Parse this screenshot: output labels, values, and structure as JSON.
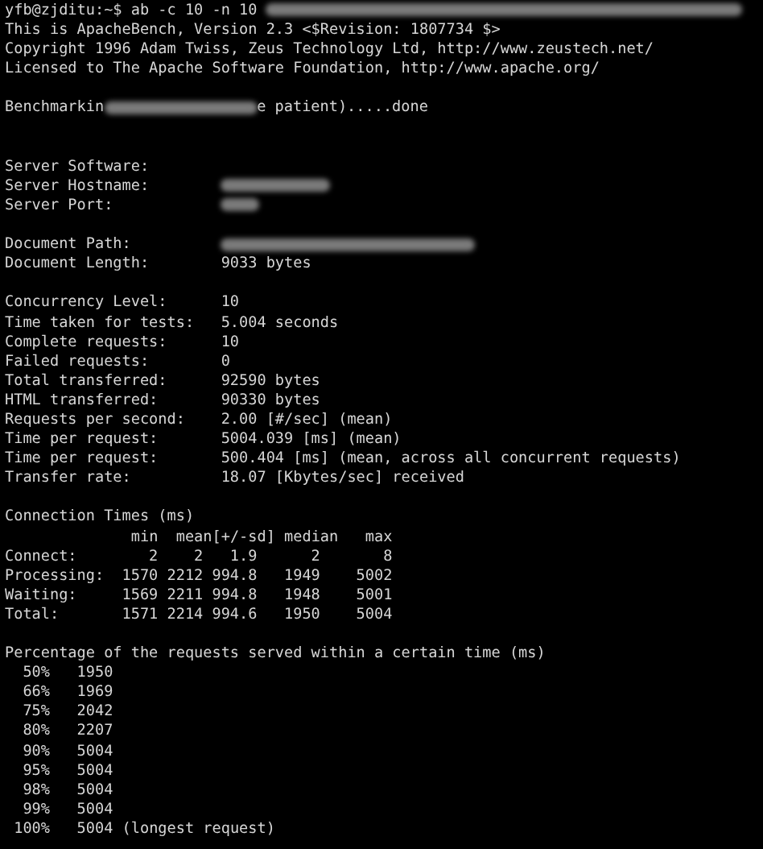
{
  "blocks": [
    {
      "lines": [
        [
          {
            "kind": "text",
            "text": "yfb@zjditu:~$ ab -c 10 -n 10 "
          },
          {
            "kind": "redacted"
          }
        ],
        [
          {
            "kind": "text",
            "text": "This is ApacheBench, Version 2.3 <$Revision: 1807734 $>"
          }
        ],
        [
          {
            "kind": "text",
            "text": "Copyright 1996 Adam Twiss, Zeus Technology Ltd, http://www.zeustech.net/"
          }
        ],
        [
          {
            "kind": "text",
            "text": "Licensed to The Apache Software Foundation, http://www.apache.org/"
          }
        ]
      ]
    },
    {
      "lines": [
        [
          {
            "kind": "text",
            "text": "Benchmarkin"
          },
          {
            "kind": "redacted"
          },
          {
            "kind": "text",
            "text": "e patient).....done"
          }
        ]
      ]
    },
    {
      "lines": [
        [
          {
            "kind": "text",
            "text": "Server Software:"
          }
        ],
        [
          {
            "kind": "text",
            "text": "Server Hostname:        "
          },
          {
            "kind": "redacted"
          }
        ],
        [
          {
            "kind": "text",
            "text": "Server Port:            "
          },
          {
            "kind": "redacted"
          }
        ]
      ]
    },
    {
      "lines": [
        [
          {
            "kind": "text",
            "text": "Document Path:          "
          },
          {
            "kind": "redacted"
          }
        ],
        [
          {
            "kind": "text",
            "text": "Document Length:        9033 bytes"
          }
        ]
      ]
    },
    {
      "lines": [
        [
          {
            "kind": "text",
            "text": "Concurrency Level:      10"
          }
        ],
        [
          {
            "kind": "text",
            "text": "Time taken for tests:   5.004 seconds"
          }
        ],
        [
          {
            "kind": "text",
            "text": "Complete requests:      10"
          }
        ],
        [
          {
            "kind": "text",
            "text": "Failed requests:        0"
          }
        ],
        [
          {
            "kind": "text",
            "text": "Total transferred:      92590 bytes"
          }
        ],
        [
          {
            "kind": "text",
            "text": "HTML transferred:       90330 bytes"
          }
        ],
        [
          {
            "kind": "text",
            "text": "Requests per second:    2.00 [#/sec] (mean)"
          }
        ],
        [
          {
            "kind": "text",
            "text": "Time per request:       5004.039 [ms] (mean)"
          }
        ],
        [
          {
            "kind": "text",
            "text": "Time per request:       500.404 [ms] (mean, across all concurrent requests)"
          }
        ],
        [
          {
            "kind": "text",
            "text": "Transfer rate:          18.07 [Kbytes/sec] received"
          }
        ]
      ]
    },
    {
      "lines": [
        [
          {
            "kind": "text",
            "text": "Connection Times (ms)"
          }
        ],
        [
          {
            "kind": "text",
            "text": "              min  mean[+/-sd] median   max"
          }
        ],
        [
          {
            "kind": "text",
            "text": "Connect:        2    2   1.9      2       8"
          }
        ],
        [
          {
            "kind": "text",
            "text": "Processing:  1570 2212 994.8   1949    5002"
          }
        ],
        [
          {
            "kind": "text",
            "text": "Waiting:     1569 2211 994.8   1948    5001"
          }
        ],
        [
          {
            "kind": "text",
            "text": "Total:       1571 2214 994.6   1950    5004"
          }
        ]
      ]
    },
    {
      "lines": [
        [
          {
            "kind": "text",
            "text": "Percentage of the requests served within a certain time (ms)"
          }
        ],
        [
          {
            "kind": "text",
            "text": "  50%   1950"
          }
        ],
        [
          {
            "kind": "text",
            "text": "  66%   1969"
          }
        ],
        [
          {
            "kind": "text",
            "text": "  75%   2042"
          }
        ],
        [
          {
            "kind": "text",
            "text": "  80%   2207"
          }
        ],
        [
          {
            "kind": "text",
            "text": "  90%   5004"
          }
        ],
        [
          {
            "kind": "text",
            "text": "  95%   5004"
          }
        ],
        [
          {
            "kind": "text",
            "text": "  98%   5004"
          }
        ],
        [
          {
            "kind": "text",
            "text": "  99%   5004"
          }
        ],
        [
          {
            "kind": "text",
            "text": " 100%   5004 (longest request)"
          }
        ]
      ]
    }
  ]
}
